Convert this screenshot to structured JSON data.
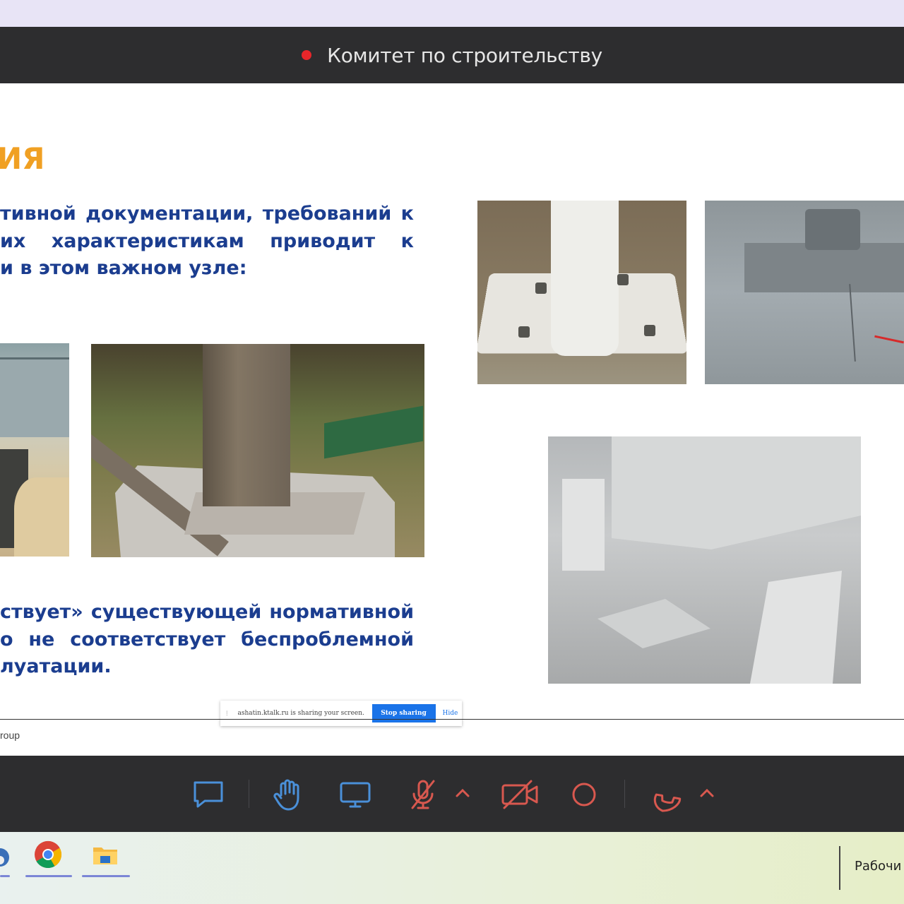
{
  "window": {
    "meeting_title": "Комитет по строительству"
  },
  "slide": {
    "heading": "ИЯ",
    "paragraph1": [
      "тивной документации, требований к",
      "их    характеристикам    приводит    к",
      "и в этом важном узле:"
    ],
    "paragraph2": [
      "ствует» существующей нормативной",
      "о  не  соответствует  беспроблемной",
      "луатации."
    ],
    "footer": "roup"
  },
  "share_notice": {
    "text": "ashatin.ktalk.ru is sharing your screen.",
    "stop_label": "Stop sharing",
    "hide_label": "Hide"
  },
  "toolbar": {
    "icons": [
      "chat-icon",
      "raise-hand-icon",
      "screen-share-icon",
      "mic-off-icon",
      "chevron-up-icon",
      "camera-off-icon",
      "record-icon",
      "hang-up-icon",
      "chevron-up-icon"
    ],
    "accent_color": "#d8584f",
    "icon_color": "#4a90d9"
  },
  "taskbar": {
    "apps": [
      "app-icon",
      "chrome-icon",
      "file-explorer-icon"
    ],
    "desktop_label": "Рабочи"
  }
}
